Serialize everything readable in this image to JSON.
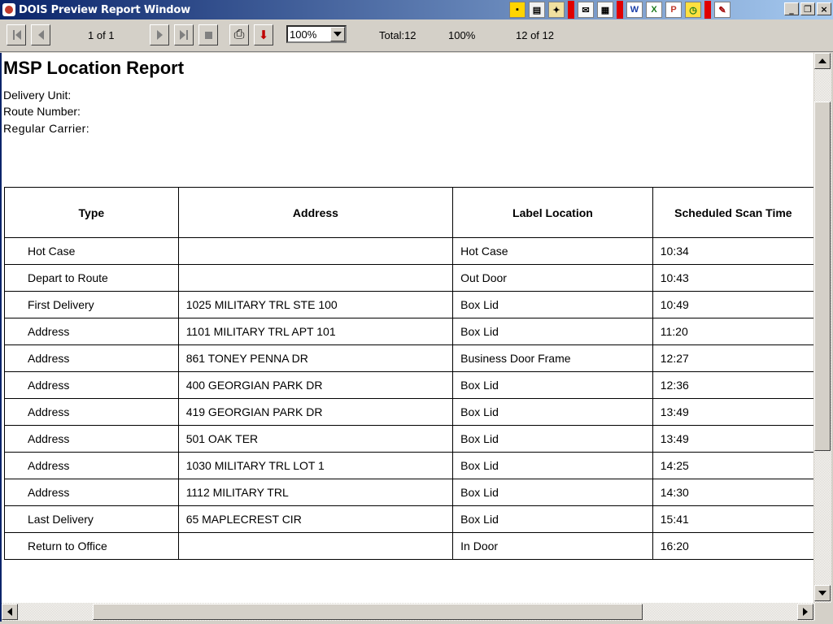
{
  "window": {
    "title": "DOIS Preview Report Window",
    "minimize": "_",
    "restore": "❐",
    "close": "×",
    "tray_icons": [
      "word-icon",
      "excel-icon",
      "powerpoint-icon",
      "clock-icon",
      "key-icon"
    ],
    "tray_glyphs": [
      "W",
      "X",
      "P",
      "◷",
      "✎"
    ]
  },
  "toolbar": {
    "page_indicator": "1 of 1",
    "zoom": "100%",
    "total": "Total:12",
    "percent": "100%",
    "record_count": "12 of 12"
  },
  "report": {
    "title": "MSP Location Report",
    "delivery_unit_label": "Delivery Unit:",
    "route_number_label": "Route Number:",
    "regular_carrier_label": "Regular Carrier:",
    "columns": [
      "Type",
      "Address",
      "Label Location",
      "Scheduled Scan Time"
    ],
    "rows": [
      [
        "Hot Case",
        "",
        "Hot Case",
        "10:34"
      ],
      [
        "Depart to Route",
        "",
        "Out Door",
        "10:43"
      ],
      [
        "First Delivery",
        "1025 MILITARY TRL STE 100",
        "Box Lid",
        "10:49"
      ],
      [
        "Address",
        "1101  MILITARY TRL  APT 101",
        "Box Lid",
        "11:20"
      ],
      [
        "Address",
        "861  TONEY PENNA DR",
        "Business Door Frame",
        "12:27"
      ],
      [
        "Address",
        "400  GEORGIAN PARK DR",
        "Box Lid",
        "12:36"
      ],
      [
        "Address",
        "419  GEORGIAN PARK DR",
        "Box Lid",
        "13:49"
      ],
      [
        "Address",
        "501  OAK TER",
        "Box Lid",
        "13:49"
      ],
      [
        "Address",
        "1030  MILITARY TRL  LOT 1",
        "Box Lid",
        "14:25"
      ],
      [
        "Address",
        "1112  MILITARY TRL",
        "Box Lid",
        "14:30"
      ],
      [
        "Last Delivery",
        "65 MAPLECREST CIR",
        "Box Lid",
        "15:41"
      ],
      [
        "Return to Office",
        "",
        "In Door",
        "16:20"
      ]
    ]
  }
}
